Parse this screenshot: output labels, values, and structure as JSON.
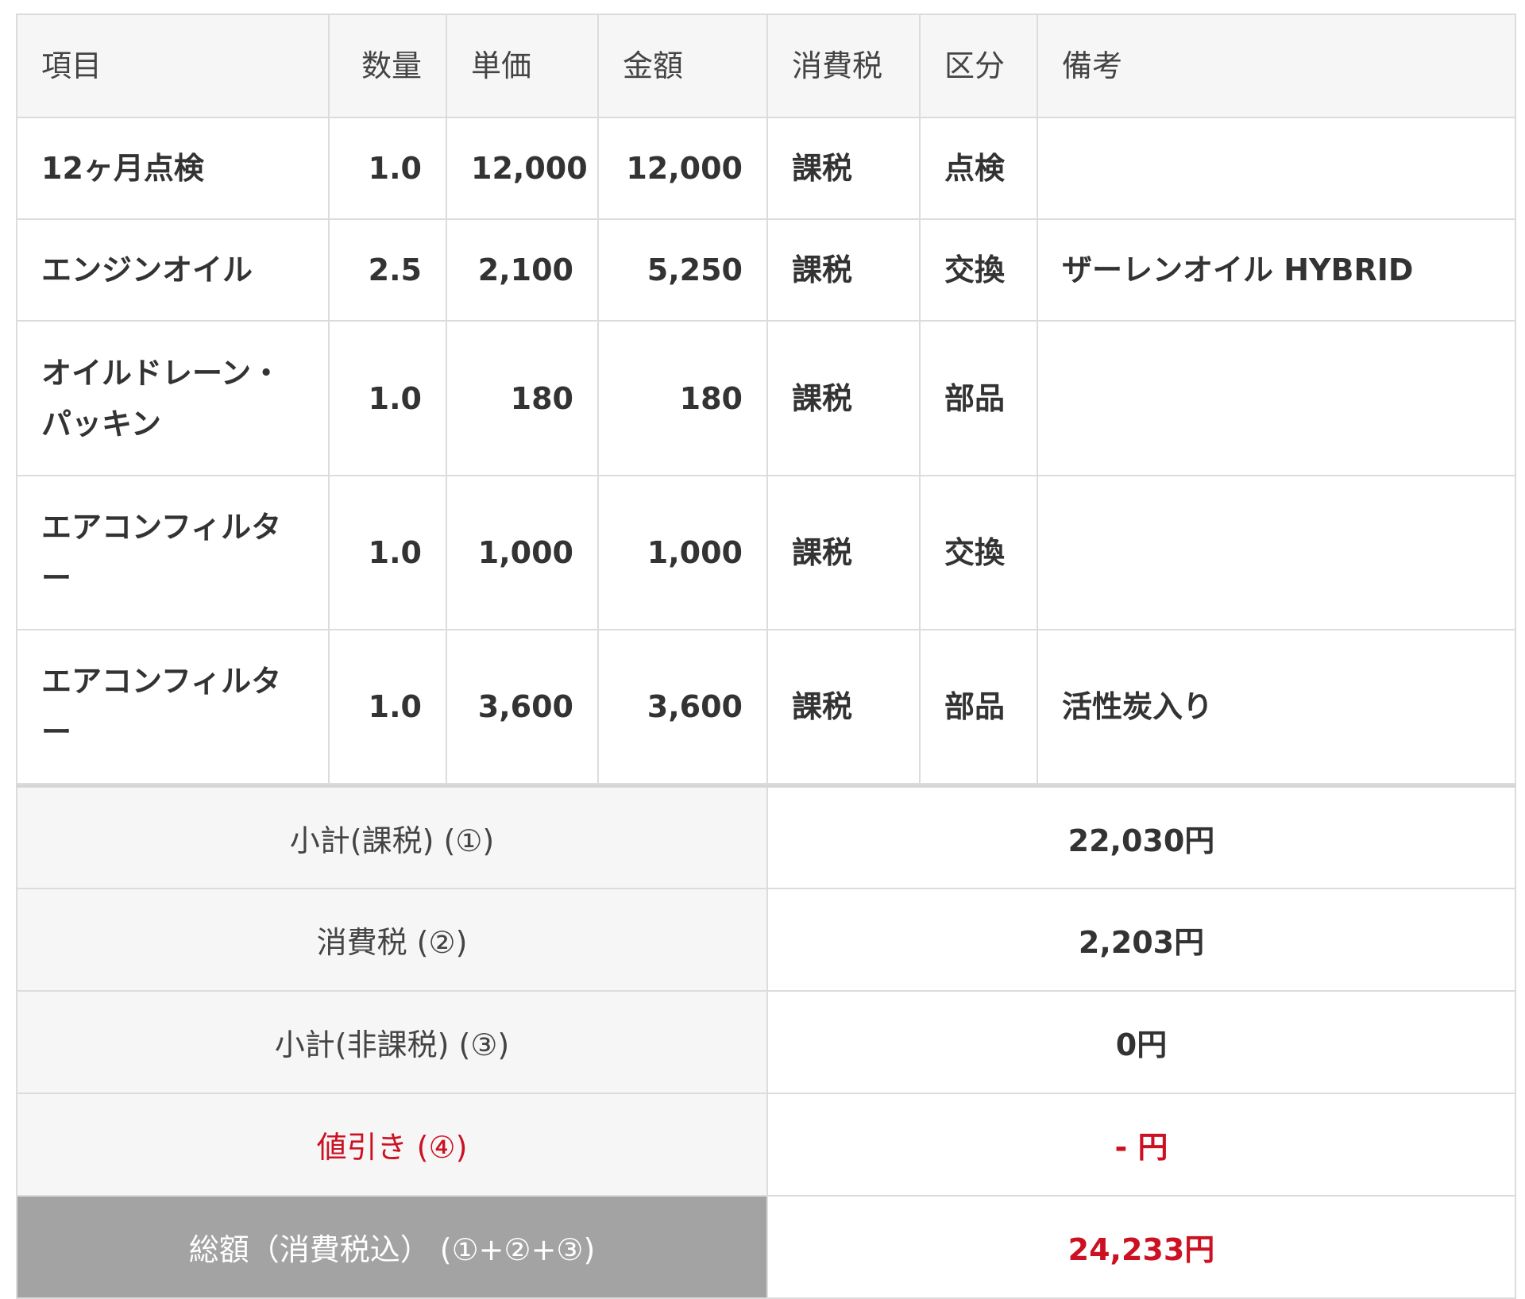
{
  "table": {
    "headers": {
      "item": "項目",
      "qty": "数量",
      "unit_price": "単価",
      "amount": "金額",
      "tax": "消費税",
      "category": "区分",
      "note": "備考"
    },
    "rows": [
      {
        "item": "12ヶ月点検",
        "qty": "1.0",
        "unit_price": "12,000",
        "amount": "12,000",
        "tax": "課税",
        "category": "点検",
        "note": ""
      },
      {
        "item": "エンジンオイル",
        "qty": "2.5",
        "unit_price": "2,100",
        "amount": "5,250",
        "tax": "課税",
        "category": "交換",
        "note": "ザーレンオイル HYBRID"
      },
      {
        "item": "オイルドレーン・パッキン",
        "qty": "1.0",
        "unit_price": "180",
        "amount": "180",
        "tax": "課税",
        "category": "部品",
        "note": ""
      },
      {
        "item": "エアコンフィルター",
        "qty": "1.0",
        "unit_price": "1,000",
        "amount": "1,000",
        "tax": "課税",
        "category": "交換",
        "note": ""
      },
      {
        "item": "エアコンフィルター",
        "qty": "1.0",
        "unit_price": "3,600",
        "amount": "3,600",
        "tax": "課税",
        "category": "部品",
        "note": "活性炭入り"
      }
    ]
  },
  "totals": {
    "subtotal_taxable": {
      "label": "小計(課税) (①)",
      "value": "22,030円"
    },
    "consumption_tax": {
      "label": "消費税 (②)",
      "value": "2,203円"
    },
    "subtotal_nontaxable": {
      "label": "小計(非課税) (③)",
      "value": "0円"
    },
    "discount": {
      "label": "値引き (④)",
      "value": "- 円"
    },
    "grand_total": {
      "label": "総額（消費税込） (①+②+③)",
      "value": "24,233円"
    }
  },
  "colors": {
    "header_bg": "#f6f6f6",
    "border": "#dcdcdc",
    "grand_label_bg": "#a3a3a3",
    "accent_red": "#cc1122",
    "text": "#333333"
  }
}
